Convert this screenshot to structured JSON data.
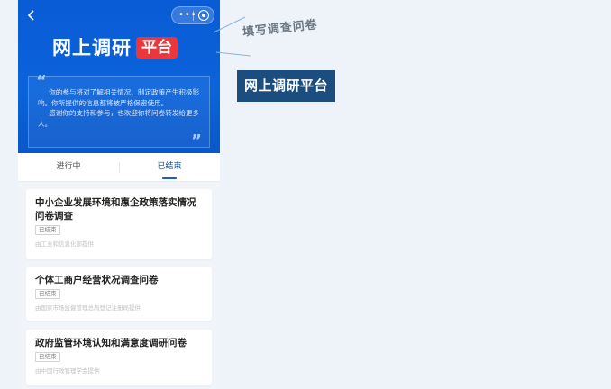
{
  "header": {
    "title_main": "网上调研",
    "title_tag": "平台",
    "quote_open": "“",
    "quote_close": "”",
    "quote_para1": "你的参与将对了解相关情况、制定政策产生积极影响。你所提供的信息都将被严格保密使用。",
    "quote_para2": "感谢你的支持和参与，也欢迎你将问卷转发给更多人。"
  },
  "tabs": {
    "ongoing": "进行中",
    "ended": "已结束"
  },
  "surveys": [
    {
      "title": "中小企业发展环境和惠企政策落实情况问卷调查",
      "status": "已结束",
      "source": "由工业和信息化部提供"
    },
    {
      "title": "个体工商户经营状况调查问卷",
      "status": "已结束",
      "source": "由国家市场监督管理总局登记注册局提供"
    },
    {
      "title": "政府监管环境认知和满意度调研问卷",
      "status": "已结束",
      "source": "由中国行政管理学会提供"
    }
  ],
  "annotations": {
    "caption": "填写调查问卷",
    "banner": "网上调研平台"
  },
  "icons": {
    "back": "chevron-left-icon",
    "menu": "more-dots-icon",
    "close": "target-circle-icon"
  },
  "colors": {
    "hero_blue": "#0b63da",
    "tag_red": "#e8383d",
    "banner_navy": "#1c4d7f"
  }
}
